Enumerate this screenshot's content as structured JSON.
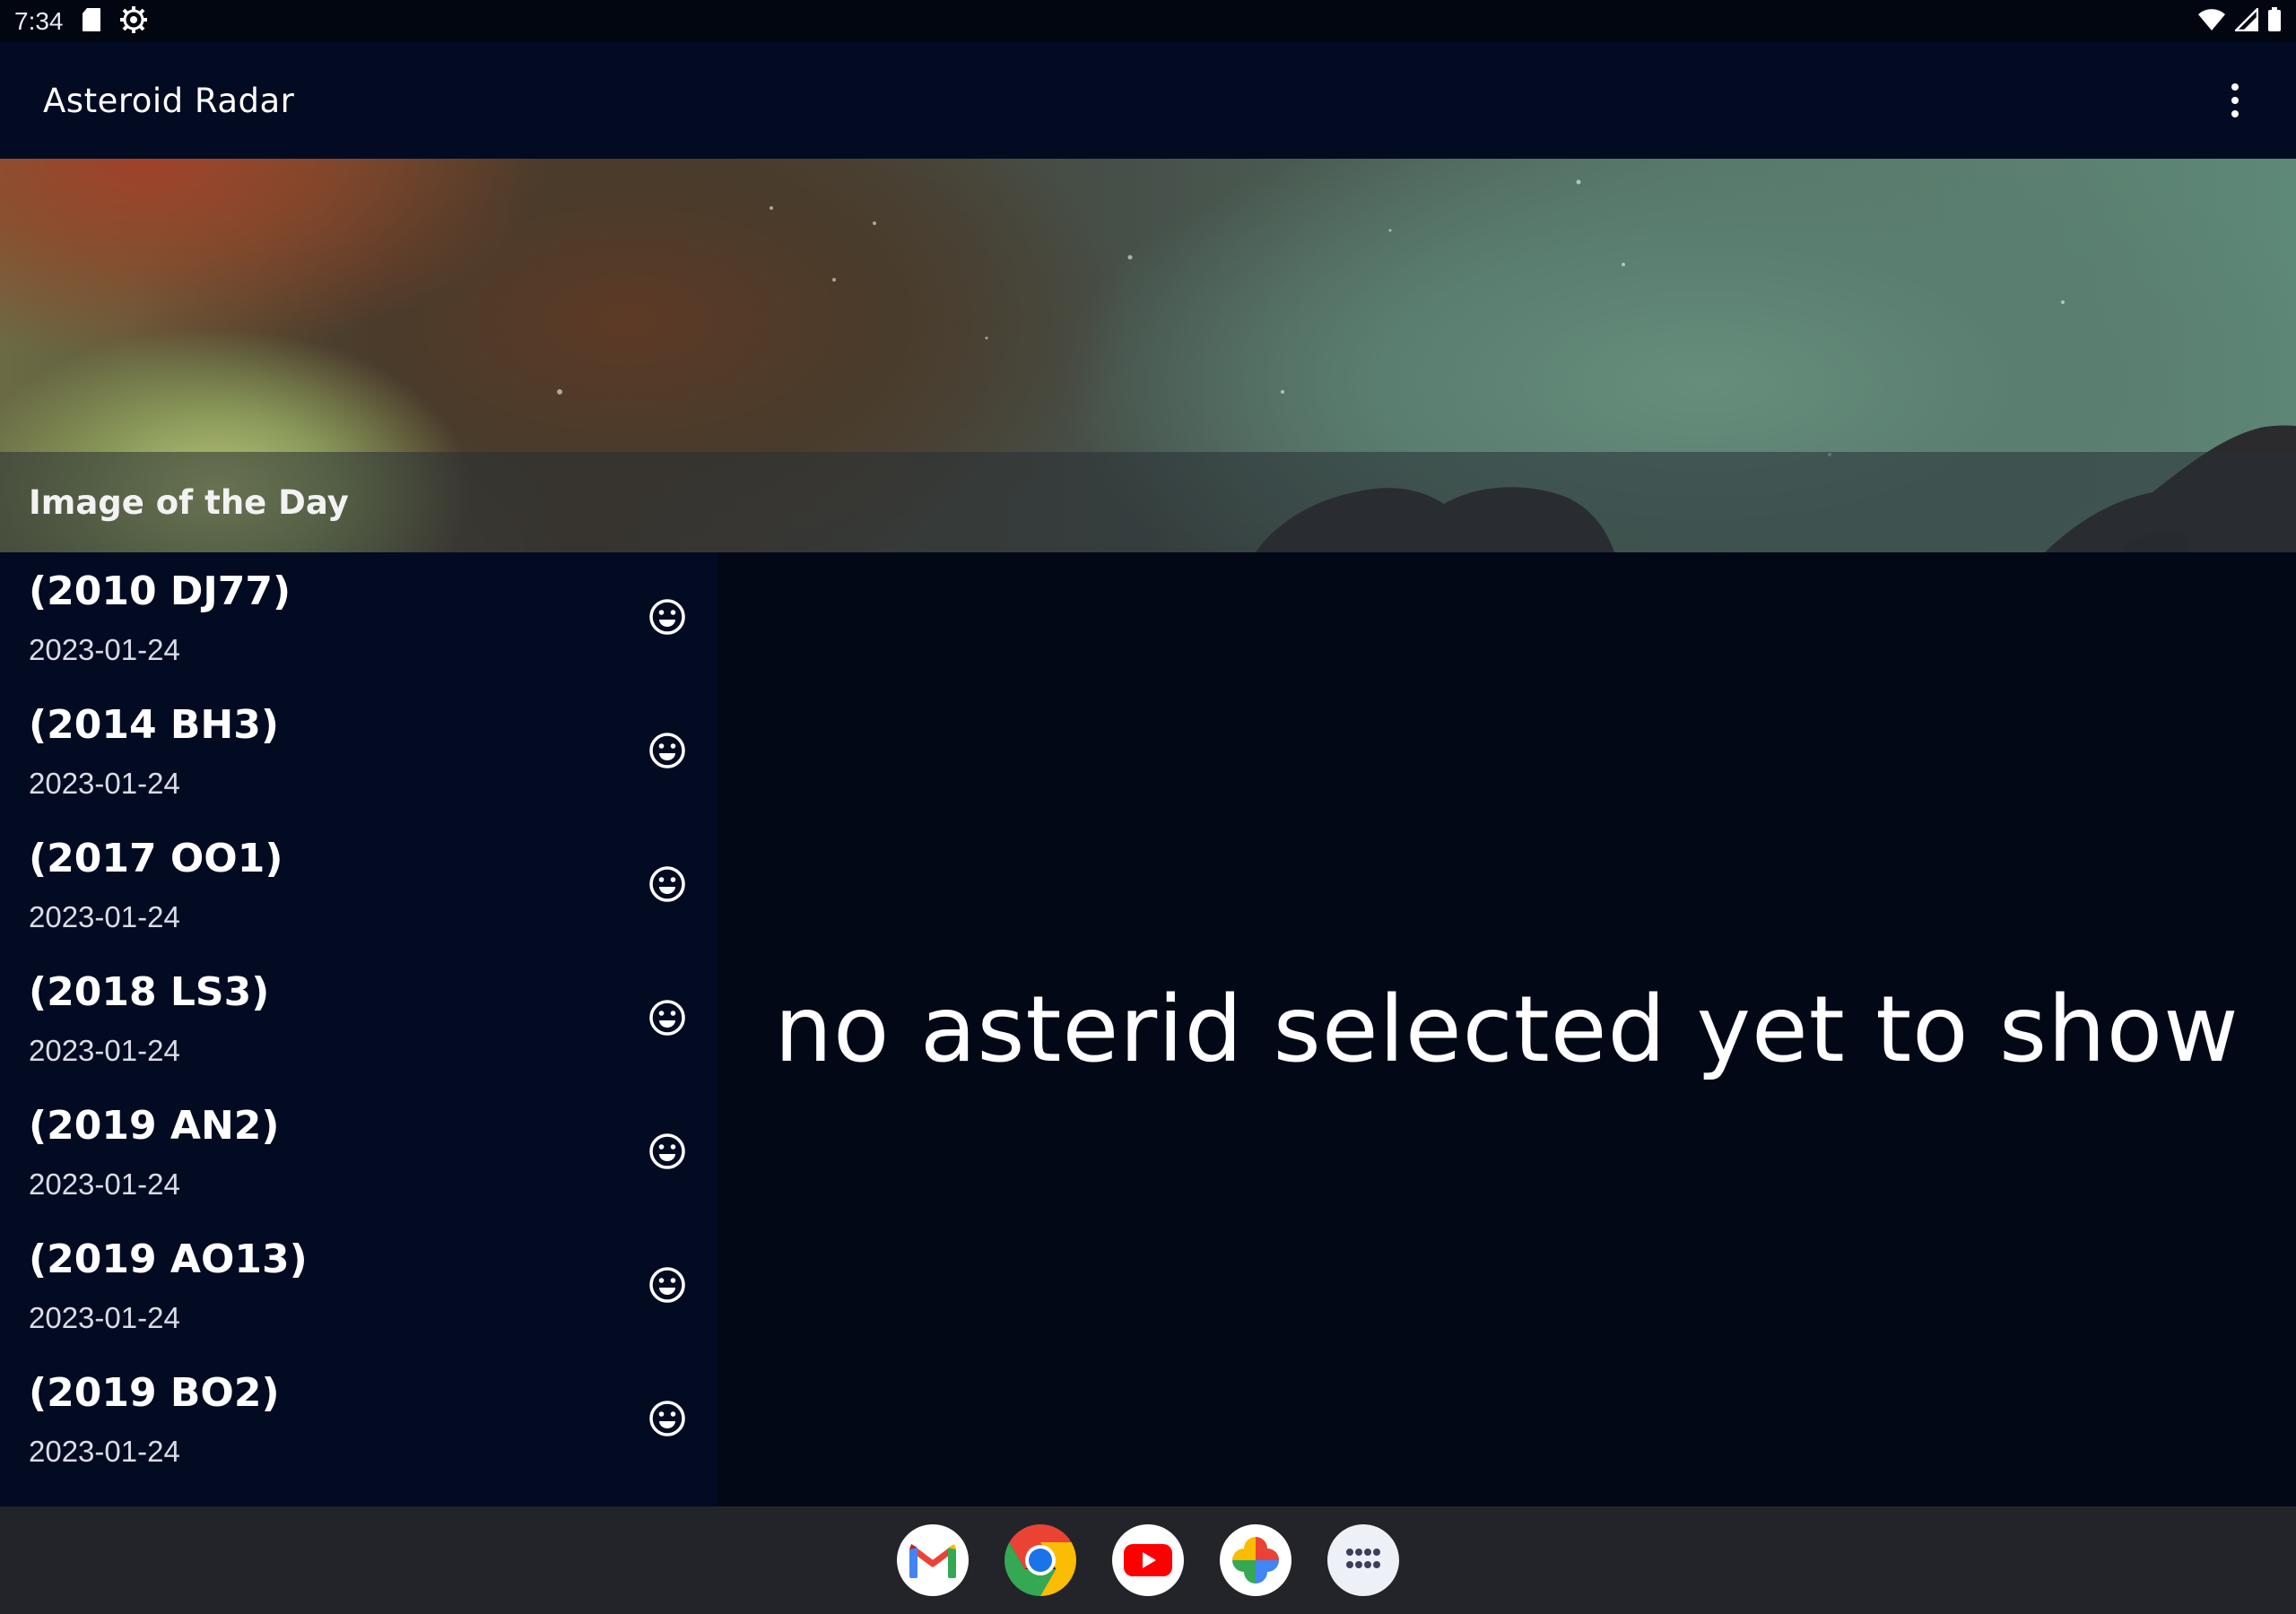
{
  "status_bar": {
    "time": "7:34",
    "left_icons": [
      "sd-card-icon",
      "settings-gear-icon"
    ],
    "right_icons": [
      "wifi-icon",
      "cell-signal-icon",
      "battery-icon"
    ]
  },
  "app_bar": {
    "title": "Asteroid Radar",
    "overflow_icon": "more-vert-icon"
  },
  "image_of_day": {
    "caption": "Image of the Day"
  },
  "asteroids": [
    {
      "name": "(2010 DJ77)",
      "date": "2023-01-24",
      "status_icon": "smiley-icon"
    },
    {
      "name": "(2014 BH3)",
      "date": "2023-01-24",
      "status_icon": "smiley-icon"
    },
    {
      "name": "(2017 OO1)",
      "date": "2023-01-24",
      "status_icon": "smiley-icon"
    },
    {
      "name": "(2018 LS3)",
      "date": "2023-01-24",
      "status_icon": "smiley-icon"
    },
    {
      "name": "(2019 AN2)",
      "date": "2023-01-24",
      "status_icon": "smiley-icon"
    },
    {
      "name": "(2019 AO13)",
      "date": "2023-01-24",
      "status_icon": "smiley-icon"
    },
    {
      "name": "(2019 BO2)",
      "date": "2023-01-24",
      "status_icon": "smiley-icon"
    }
  ],
  "detail": {
    "empty_message": "no asterid selected yet to show"
  },
  "taskbar": {
    "apps": [
      "gmail-icon",
      "chrome-icon",
      "youtube-icon",
      "photos-icon",
      "app-drawer-icon"
    ]
  },
  "colors": {
    "app_bar_bg": "#020b22",
    "detail_bg": "#030817",
    "taskbar_bg": "#23242a"
  }
}
